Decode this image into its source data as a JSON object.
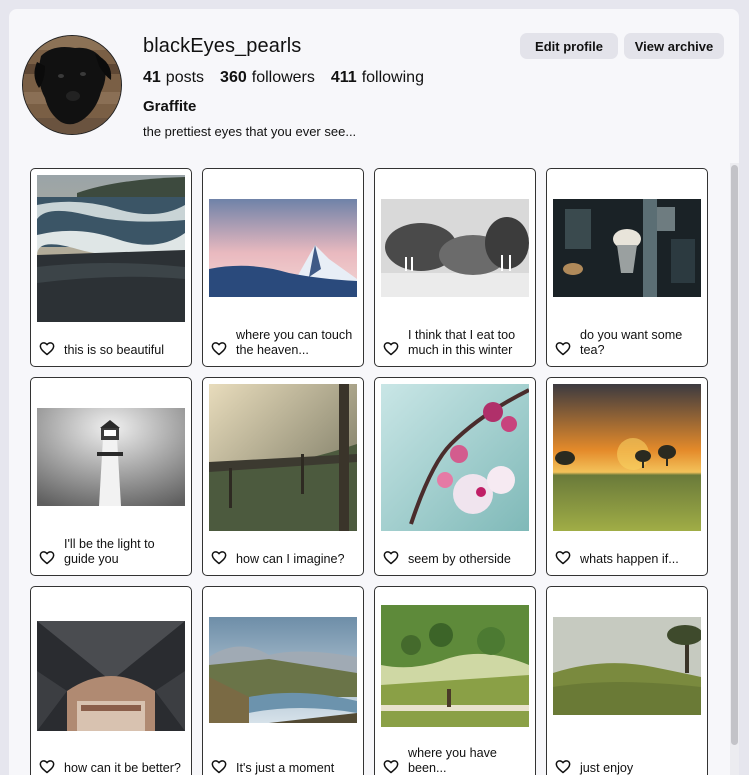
{
  "profile": {
    "username": "blackEyes_pearls",
    "edit_label": "Edit profile",
    "archive_label": "View archive",
    "posts_count": "41",
    "posts_label": "posts",
    "followers_count": "360",
    "followers_label": "followers",
    "following_count": "411",
    "following_label": "following",
    "full_name": "Graffite",
    "bio": "the prettiest eyes that you ever see..."
  },
  "posts": [
    {
      "caption": "this is so beautiful",
      "image": "sea-waves-beach"
    },
    {
      "caption": "where you can touch the heaven...",
      "image": "snowy-mountain-sunset"
    },
    {
      "caption": "I think that I eat too much in this winter",
      "image": "walruses-bw"
    },
    {
      "caption": "do you want some tea?",
      "image": "coffee-bar"
    },
    {
      "caption": "I'll be the light to guide you",
      "image": "lighthouse-bw"
    },
    {
      "caption": "how can I imagine?",
      "image": "foggy-forest-bridge"
    },
    {
      "caption": "seem by otherside",
      "image": "cherry-blossom"
    },
    {
      "caption": "whats happen if...",
      "image": "savanna-sunset"
    },
    {
      "caption": "how can it be better?",
      "image": "train-station-roof"
    },
    {
      "caption": "It's just a moment",
      "image": "mountain-lake"
    },
    {
      "caption": "where you have been...",
      "image": "sheep-hills"
    },
    {
      "caption": "just enjoy",
      "image": "foggy-hill-tree"
    }
  ],
  "colors": {
    "background": "#e6e6ee",
    "panel": "#f7f7fa",
    "button": "#e3e3ea"
  }
}
